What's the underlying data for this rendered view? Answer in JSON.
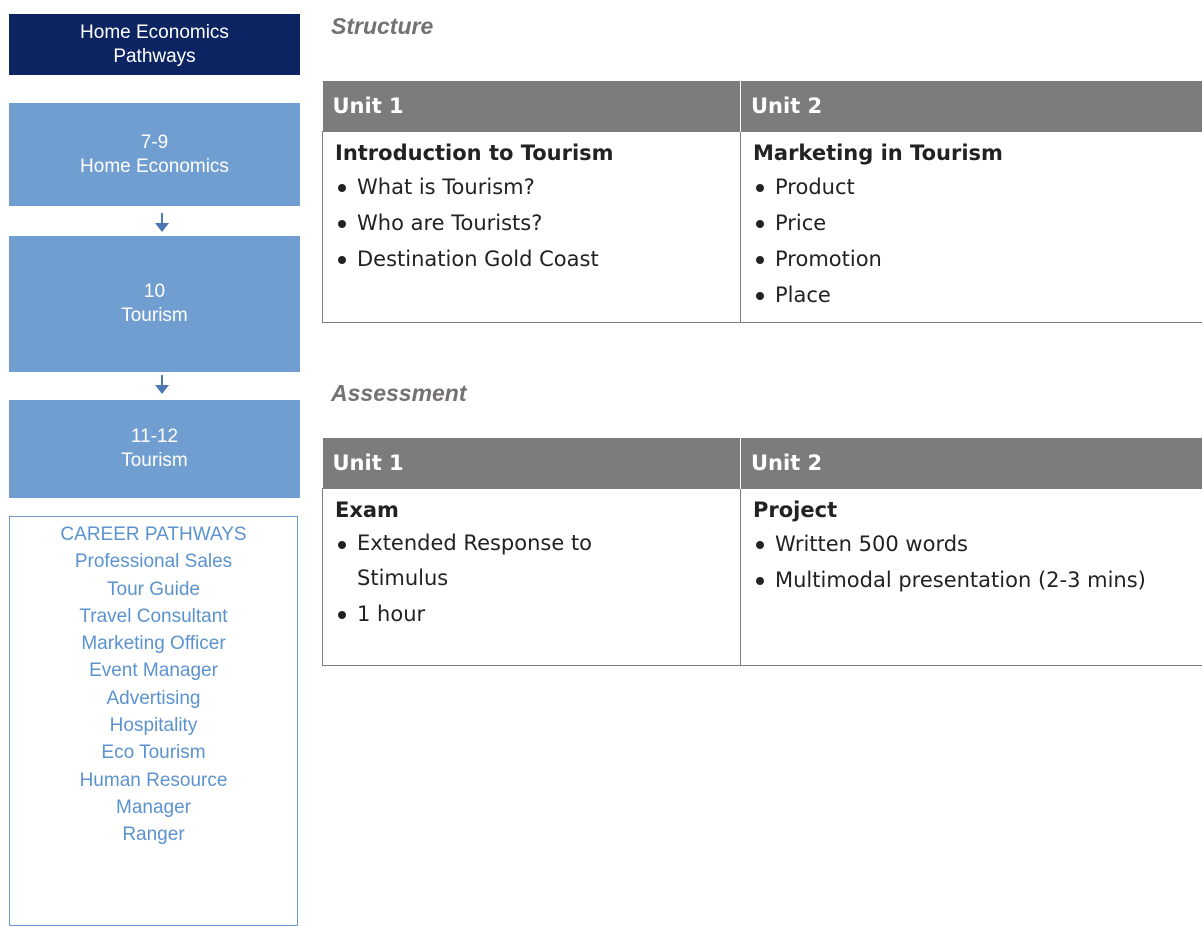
{
  "sidebar": {
    "header": {
      "line1": "Home Economics",
      "line2": "Pathways"
    },
    "stages": [
      {
        "line1": "7-9",
        "line2": "Home Economics"
      },
      {
        "line1": "10",
        "line2": "Tourism"
      },
      {
        "line1": "11-12",
        "line2": "Tourism"
      }
    ],
    "career": {
      "title": "CAREER PATHWAYS",
      "items": [
        "Professional Sales",
        "Tour Guide",
        "Travel Consultant",
        "Marketing Officer",
        "Event Manager",
        "Advertising",
        "Hospitality",
        "Eco Tourism",
        "Human Resource",
        "Manager",
        "Ranger"
      ]
    },
    "colors": {
      "header": "#0c2461",
      "stage": "#719ed1",
      "career_text": "#5b93cf"
    }
  },
  "structure": {
    "title": "Structure",
    "unit1": {
      "header": "Unit 1",
      "heading": "Introduction to Tourism",
      "bullets": [
        "What is Tourism?",
        "Who are Tourists?",
        "Destination Gold Coast"
      ]
    },
    "unit2": {
      "header": "Unit 2",
      "heading": "Marketing in Tourism",
      "bullets": [
        "Product",
        "Price",
        "Promotion",
        "Place"
      ]
    }
  },
  "assessment": {
    "title": "Assessment",
    "unit1": {
      "header": "Unit 1",
      "heading": "Exam",
      "bullets": [
        "Extended Response to Stimulus",
        "1 hour"
      ]
    },
    "unit2": {
      "header": "Unit 2",
      "heading": "Project",
      "bullets": [
        "Written 500 words",
        "Multimodal presentation (2-3 mins)"
      ]
    }
  },
  "table_header_color": "#7b7c7e"
}
